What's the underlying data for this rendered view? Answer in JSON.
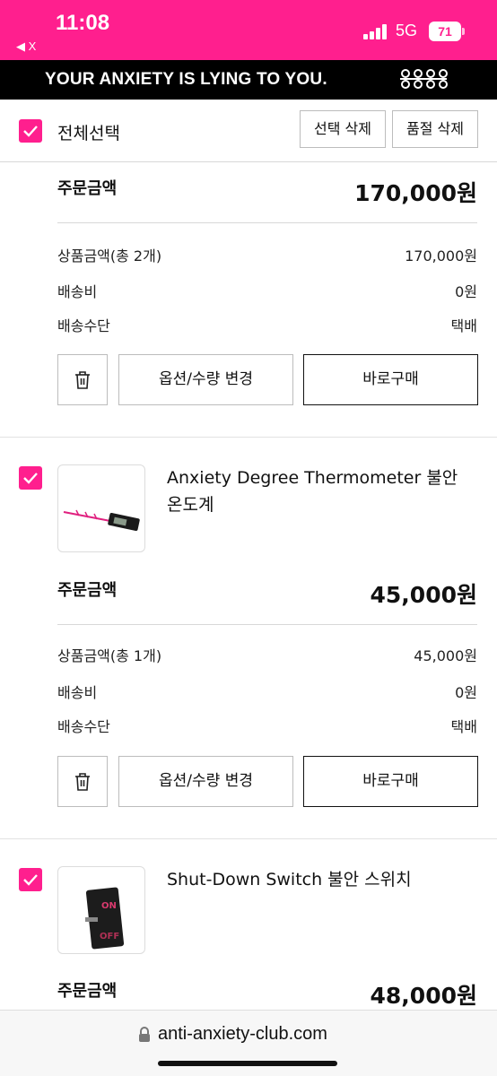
{
  "status_bar": {
    "time": "11:08",
    "back_label": "◀ X",
    "network": "5G",
    "battery": "71",
    "accent_color": "#ff1f8e"
  },
  "banner": {
    "text": "YOUR ANXIETY IS LYING TO YOU.",
    "logo_icon": "brand-logo-icon"
  },
  "select_bar": {
    "select_all_label": "전체선택",
    "delete_selected": "선택 삭제",
    "delete_soldout": "품절 삭제"
  },
  "items": [
    {
      "order_label": "주문금액",
      "order_amount": "170,000원",
      "rows": [
        {
          "label": "상품금액(총 2개)",
          "value": "170,000원"
        },
        {
          "label": "배송비",
          "value": "0원"
        },
        {
          "label": "배송수단",
          "value": "택배"
        }
      ],
      "option_button": "옵션/수량 변경",
      "buy_button": "바로구매"
    },
    {
      "name": "Anxiety Degree Thermometer 불안 온도계",
      "order_label": "주문금액",
      "order_amount": "45,000원",
      "rows": [
        {
          "label": "상품금액(총 1개)",
          "value": "45,000원"
        },
        {
          "label": "배송비",
          "value": "0원"
        },
        {
          "label": "배송수단",
          "value": "택배"
        }
      ],
      "option_button": "옵션/수량 변경",
      "buy_button": "바로구매"
    },
    {
      "name": "Shut-Down Switch 불안 스위치",
      "order_label": "주문금액",
      "order_amount": "48,000원"
    }
  ],
  "url_bar": {
    "url": "anti-anxiety-club.com"
  }
}
